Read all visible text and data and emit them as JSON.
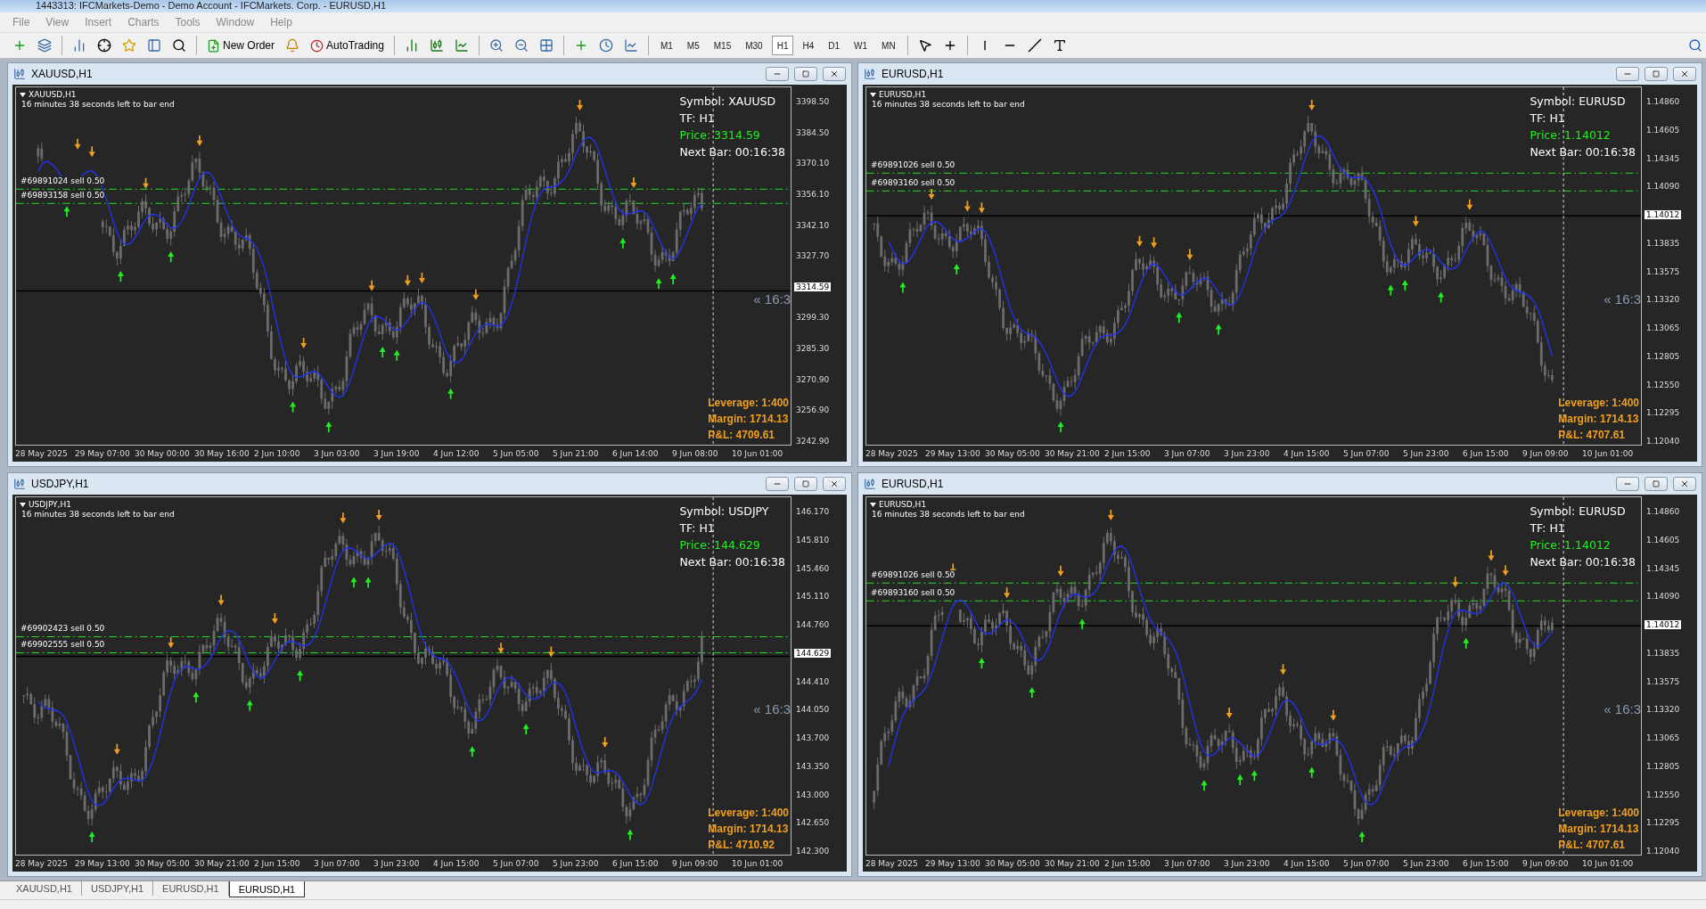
{
  "window": {
    "title": "1443313: IFCMarkets-Demo - Demo Account - IFCMarkets. Corp. - EURUSD,H1"
  },
  "menu": [
    "File",
    "View",
    "Insert",
    "Charts",
    "Tools",
    "Window",
    "Help"
  ],
  "toolbar": {
    "buttons": [
      "New Order",
      "AutoTrading"
    ],
    "timeframes": [
      {
        "label": "M1",
        "selected": false
      },
      {
        "label": "M5",
        "selected": false
      },
      {
        "label": "M15",
        "selected": false
      },
      {
        "label": "M30",
        "selected": false
      },
      {
        "label": "H1",
        "selected": true
      },
      {
        "label": "H4",
        "selected": false
      },
      {
        "label": "D1",
        "selected": false
      },
      {
        "label": "W1",
        "selected": false
      },
      {
        "label": "MN",
        "selected": false
      }
    ]
  },
  "charts": [
    {
      "title": "XAUUSD,H1",
      "symbol_label": "XAUUSD,H1",
      "countdown": "16 minutes 38 seconds left to bar end",
      "orders": [
        "#69891024 sell 0.50",
        "#69893158 sell 0.50"
      ],
      "info": [
        "Symbol: XAUUSD",
        "TF: H1",
        "Price: 3314.59",
        "Next Bar: 00:16:38"
      ],
      "account": [
        "Leverage: 1:400",
        "Margin: 1714.13",
        "P&L: 4709.61"
      ],
      "ghost": "« 16:3",
      "price_axis": [
        {
          "text": "3398.50",
          "current": false
        },
        {
          "text": "3384.50",
          "current": false
        },
        {
          "text": "3370.10",
          "current": false
        },
        {
          "text": "3356.10",
          "current": false
        },
        {
          "text": "3342.10",
          "current": false
        },
        {
          "text": "3327.70",
          "current": false
        },
        {
          "text": "3314.59",
          "current": true
        },
        {
          "text": "3299.30",
          "current": false
        },
        {
          "text": "3285.30",
          "current": false
        },
        {
          "text": "3270.90",
          "current": false
        },
        {
          "text": "3256.90",
          "current": false
        },
        {
          "text": "3242.90",
          "current": false
        }
      ],
      "time_axis": [
        "28 May 2025",
        "29 May 07:00",
        "30 May 00:00",
        "30 May 16:00",
        "2 Jun 10:00",
        "3 Jun 03:00",
        "3 Jun 19:00",
        "4 Jun 12:00",
        "5 Jun 05:00",
        "5 Jun 21:00",
        "6 Jun 14:00",
        "9 Jun 08:00",
        "10 Jun 01:00"
      ]
    },
    {
      "title": "EURUSD,H1",
      "symbol_label": "EURUSD,H1",
      "countdown": "16 minutes 38 seconds left to bar end",
      "orders": [
        "#69891026 sell 0.50",
        "#69893160 sell 0.50"
      ],
      "info": [
        "Symbol: EURUSD",
        "TF: H1",
        "Price: 1.14012",
        "Next Bar: 00:16:38"
      ],
      "account": [
        "Leverage: 1:400",
        "Margin: 1714.13",
        "P&L: 4707.61"
      ],
      "ghost": "« 16:3",
      "price_axis": [
        {
          "text": "1.14860",
          "current": false
        },
        {
          "text": "1.14605",
          "current": false
        },
        {
          "text": "1.14345",
          "current": false
        },
        {
          "text": "1.14090",
          "current": false
        },
        {
          "text": "1.14012",
          "current": true
        },
        {
          "text": "1.13835",
          "current": false
        },
        {
          "text": "1.13575",
          "current": false
        },
        {
          "text": "1.13320",
          "current": false
        },
        {
          "text": "1.13065",
          "current": false
        },
        {
          "text": "1.12805",
          "current": false
        },
        {
          "text": "1.12550",
          "current": false
        },
        {
          "text": "1.12295",
          "current": false
        },
        {
          "text": "1.12040",
          "current": false
        }
      ],
      "time_axis": [
        "28 May 2025",
        "29 May 13:00",
        "30 May 05:00",
        "30 May 21:00",
        "2 Jun 15:00",
        "3 Jun 07:00",
        "3 Jun 23:00",
        "4 Jun 15:00",
        "5 Jun 07:00",
        "5 Jun 23:00",
        "6 Jun 15:00",
        "9 Jun 09:00",
        "10 Jun 01:00"
      ]
    },
    {
      "title": "USDJPY,H1",
      "symbol_label": "USDJPY,H1",
      "countdown": "16 minutes 38 seconds left to bar end",
      "orders": [
        "#69902423 sell 0.50",
        "#69902555 sell 0.50"
      ],
      "info": [
        "Symbol: USDJPY",
        "TF: H1",
        "Price: 144.629",
        "Next Bar: 00:16:38"
      ],
      "account": [
        "Leverage: 1:400",
        "Margin: 1714.13",
        "P&L: 4710.92"
      ],
      "ghost": "« 16:3",
      "price_axis": [
        {
          "text": "146.170",
          "current": false
        },
        {
          "text": "145.810",
          "current": false
        },
        {
          "text": "145.460",
          "current": false
        },
        {
          "text": "145.110",
          "current": false
        },
        {
          "text": "144.760",
          "current": false
        },
        {
          "text": "144.629",
          "current": true
        },
        {
          "text": "144.410",
          "current": false
        },
        {
          "text": "144.050",
          "current": false
        },
        {
          "text": "143.700",
          "current": false
        },
        {
          "text": "143.350",
          "current": false
        },
        {
          "text": "143.000",
          "current": false
        },
        {
          "text": "142.650",
          "current": false
        },
        {
          "text": "142.300",
          "current": false
        }
      ],
      "time_axis": [
        "28 May 2025",
        "29 May 13:00",
        "30 May 05:00",
        "30 May 21:00",
        "2 Jun 15:00",
        "3 Jun 07:00",
        "3 Jun 23:00",
        "4 Jun 15:00",
        "5 Jun 07:00",
        "5 Jun 23:00",
        "6 Jun 15:00",
        "9 Jun 09:00",
        "10 Jun 01:00"
      ]
    },
    {
      "title": "EURUSD,H1",
      "symbol_label": "EURUSD,H1",
      "countdown": "16 minutes 38 seconds left to bar end",
      "orders": [
        "#69891026 sell 0.50",
        "#69893160 sell 0.50"
      ],
      "info": [
        "Symbol: EURUSD",
        "TF: H1",
        "Price: 1.14012",
        "Next Bar: 00:16:38"
      ],
      "account": [
        "Leverage: 1:400",
        "Margin: 1714.13",
        "P&L: 4707.61"
      ],
      "ghost": "« 16:3",
      "price_axis": [
        {
          "text": "1.14860",
          "current": false
        },
        {
          "text": "1.14605",
          "current": false
        },
        {
          "text": "1.14345",
          "current": false
        },
        {
          "text": "1.14090",
          "current": false
        },
        {
          "text": "1.14012",
          "current": true
        },
        {
          "text": "1.13835",
          "current": false
        },
        {
          "text": "1.13575",
          "current": false
        },
        {
          "text": "1.13320",
          "current": false
        },
        {
          "text": "1.13065",
          "current": false
        },
        {
          "text": "1.12805",
          "current": false
        },
        {
          "text": "1.12550",
          "current": false
        },
        {
          "text": "1.12295",
          "current": false
        },
        {
          "text": "1.12040",
          "current": false
        }
      ],
      "time_axis": [
        "28 May 2025",
        "29 May 13:00",
        "30 May 05:00",
        "30 May 21:00",
        "2 Jun 15:00",
        "3 Jun 07:00",
        "3 Jun 23:00",
        "4 Jun 15:00",
        "5 Jun 07:00",
        "5 Jun 23:00",
        "6 Jun 15:00",
        "9 Jun 09:00",
        "10 Jun 01:00"
      ]
    }
  ],
  "chart_tabs": [
    {
      "label": "XAUUSD,H1",
      "selected": false
    },
    {
      "label": "USDJPY,H1",
      "selected": false
    },
    {
      "label": "EURUSD,H1",
      "selected": false
    },
    {
      "label": "EURUSD,H1",
      "selected": true
    }
  ]
}
